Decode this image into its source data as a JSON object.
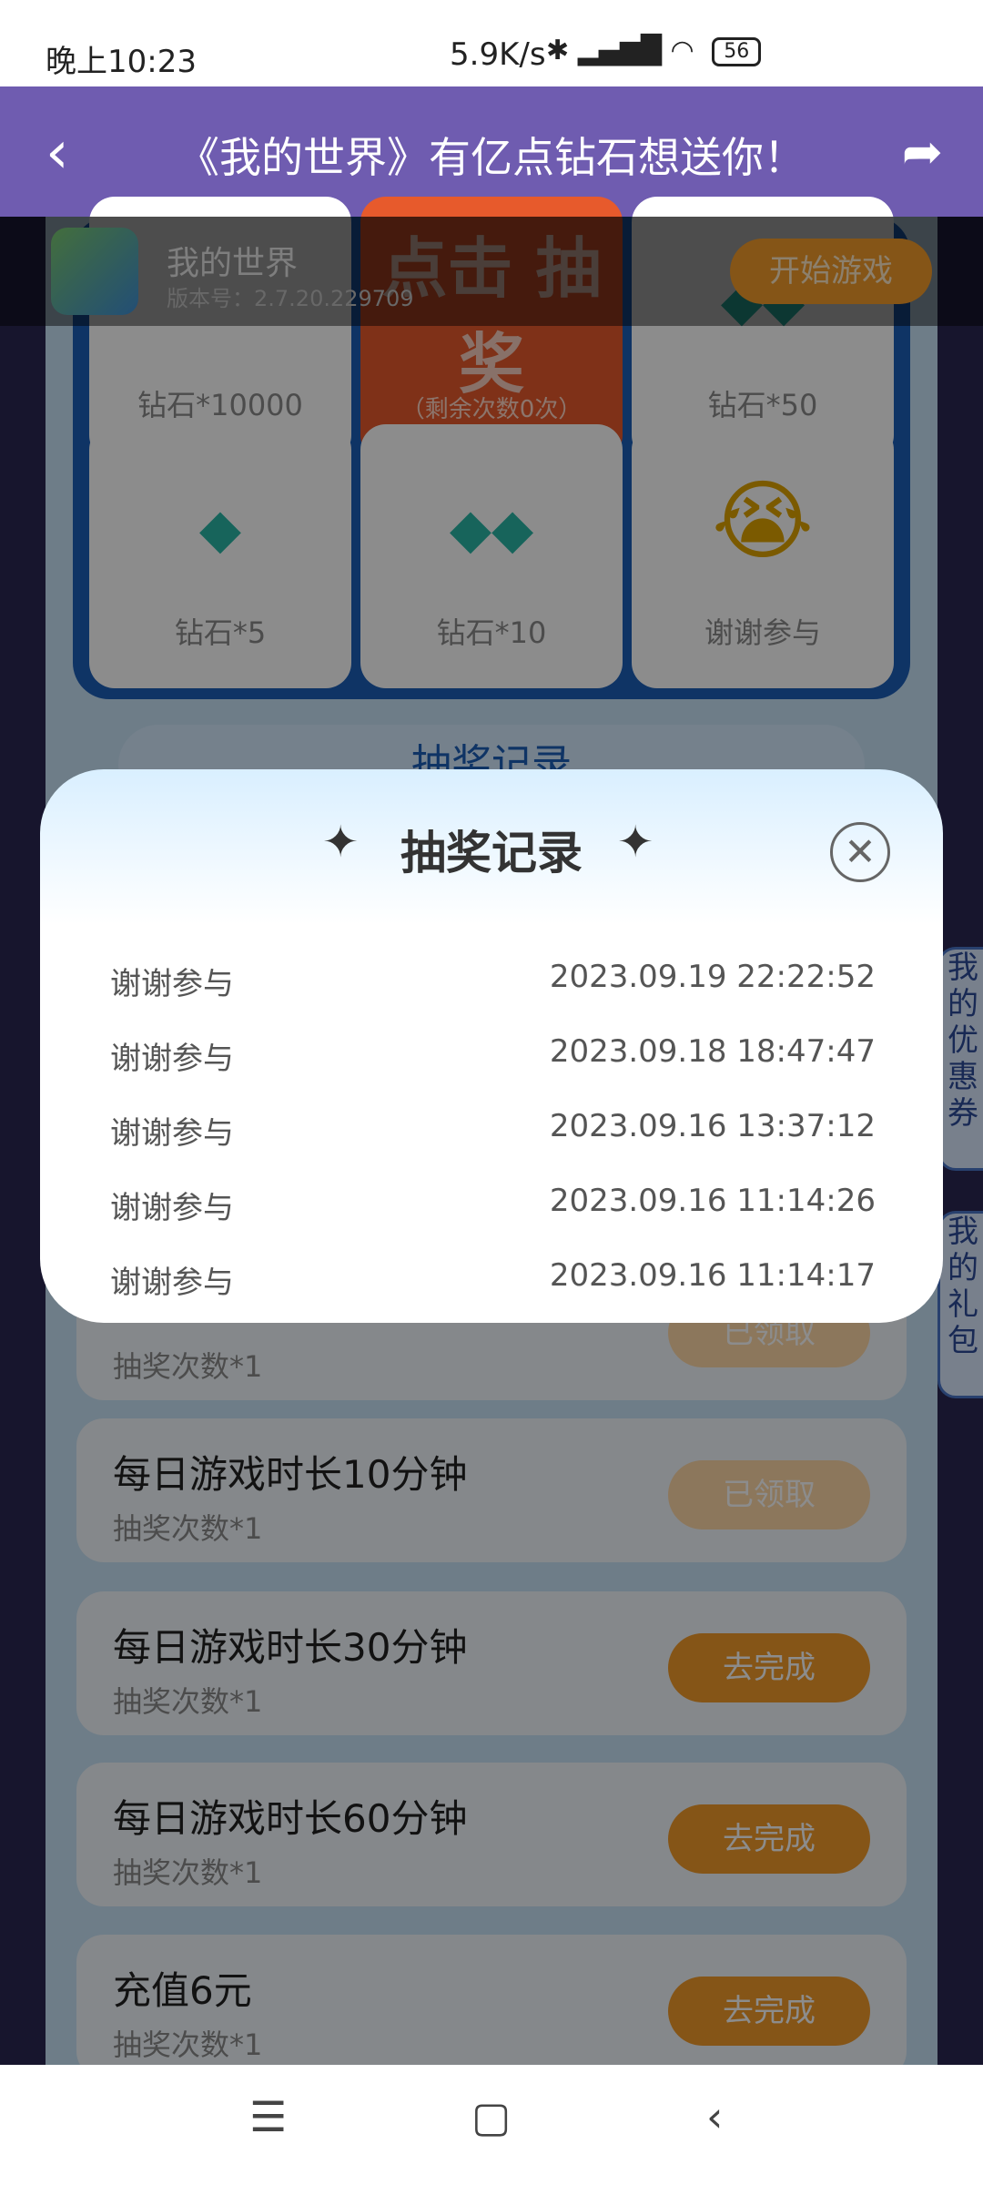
{
  "status_bar": {
    "time": "晚上10:23",
    "speed": "5.9K/s",
    "battery": "56"
  },
  "header": {
    "title": "《我的世界》有亿点钻石想送你！"
  },
  "game": {
    "name": "我的世界",
    "version": "版本号：2.7.20.229709",
    "play_label": "开始游戏"
  },
  "grid": {
    "top_left": "钻石*10000",
    "center_big": "点击\n抽奖",
    "center_sub": "（剩余次数0次）",
    "top_right": "钻石*50",
    "bottom_left": "钻石*5",
    "bottom_mid": "钻石*10",
    "bottom_right": "谢谢参与"
  },
  "record_button": "抽奖记录",
  "side_tabs": {
    "coupons": "我的优惠券",
    "gifts": "我的礼包"
  },
  "tasks": [
    {
      "title": "",
      "sub": "抽奖次数*1",
      "btn": "已领取"
    },
    {
      "title": "每日游戏时长10分钟",
      "sub": "抽奖次数*1",
      "btn": "已领取"
    },
    {
      "title": "每日游戏时长30分钟",
      "sub": "抽奖次数*1",
      "btn": "去完成"
    },
    {
      "title": "每日游戏时长60分钟",
      "sub": "抽奖次数*1",
      "btn": "去完成"
    },
    {
      "title": "充值6元",
      "sub": "抽奖次数*1",
      "btn": "去完成"
    }
  ],
  "modal": {
    "title": "抽奖记录",
    "records": [
      {
        "name": "谢谢参与",
        "date": "2023.09.19 22:22:52"
      },
      {
        "name": "谢谢参与",
        "date": "2023.09.18 18:47:47"
      },
      {
        "name": "谢谢参与",
        "date": "2023.09.16 13:37:12"
      },
      {
        "name": "谢谢参与",
        "date": "2023.09.16 11:14:26"
      },
      {
        "name": "谢谢参与",
        "date": "2023.09.16 11:14:17"
      }
    ]
  }
}
